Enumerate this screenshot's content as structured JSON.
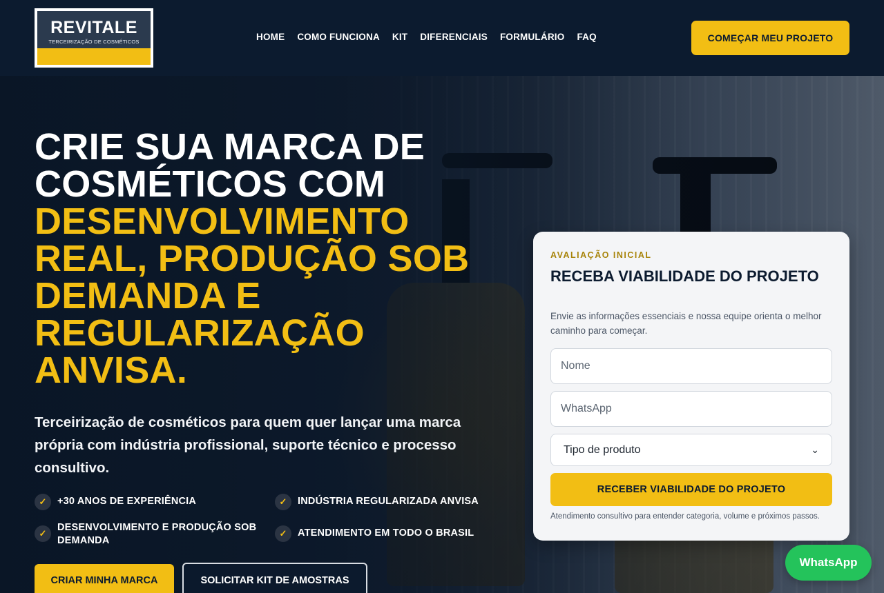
{
  "brand": {
    "name": "REVITALE",
    "tagline": "TERCEIRIZAÇÃO DE COSMÉTICOS"
  },
  "nav": {
    "items": [
      {
        "label": "HOME"
      },
      {
        "label": "COMO FUNCIONA"
      },
      {
        "label": "KIT"
      },
      {
        "label": "DIFERENCIAIS"
      },
      {
        "label": "FORMULÁRIO"
      },
      {
        "label": "FAQ"
      }
    ],
    "cta": "COMEÇAR MEU PROJETO"
  },
  "hero": {
    "headline_white": [
      "CRIE SUA MARCA DE",
      "COSMÉTICOS COM"
    ],
    "headline_yellow": [
      "DESENVOLVIMENTO",
      "REAL, PRODUÇÃO SOB",
      "DEMANDA E",
      "REGULARIZAÇÃO",
      "ANVISA."
    ],
    "subtext": "Terceirização de cosméticos para quem quer lançar uma marca própria com indústria profissional, suporte técnico e processo consultivo.",
    "features": [
      "+30 ANOS DE EXPERIÊNCIA",
      "INDÚSTRIA REGULARIZADA ANVISA",
      "DESENVOLVIMENTO E PRODUÇÃO SOB DEMANDA",
      "ATENDIMENTO EM TODO O BRASIL"
    ],
    "primary_button": "CRIAR MINHA MARCA",
    "secondary_button": "SOLICITAR KIT DE AMOSTRAS"
  },
  "form": {
    "eyebrow": "AVALIAÇÃO INICIAL",
    "title": "RECEBA VIABILIDADE DO PROJETO",
    "description": "Envie as informações essenciais e nossa equipe orienta o melhor caminho para começar.",
    "name_placeholder": "Nome",
    "whatsapp_placeholder": "WhatsApp",
    "product_type_selected": "Tipo de produto",
    "submit": "RECEBER VIABILIDADE DO PROJETO",
    "note": "Atendimento consultivo para entender categoria, volume e próximos passos."
  },
  "whatsapp_button": "WhatsApp",
  "colors": {
    "navy": "#0c1b2f",
    "accent": "#f2be14",
    "whatsapp": "#24c35b"
  }
}
